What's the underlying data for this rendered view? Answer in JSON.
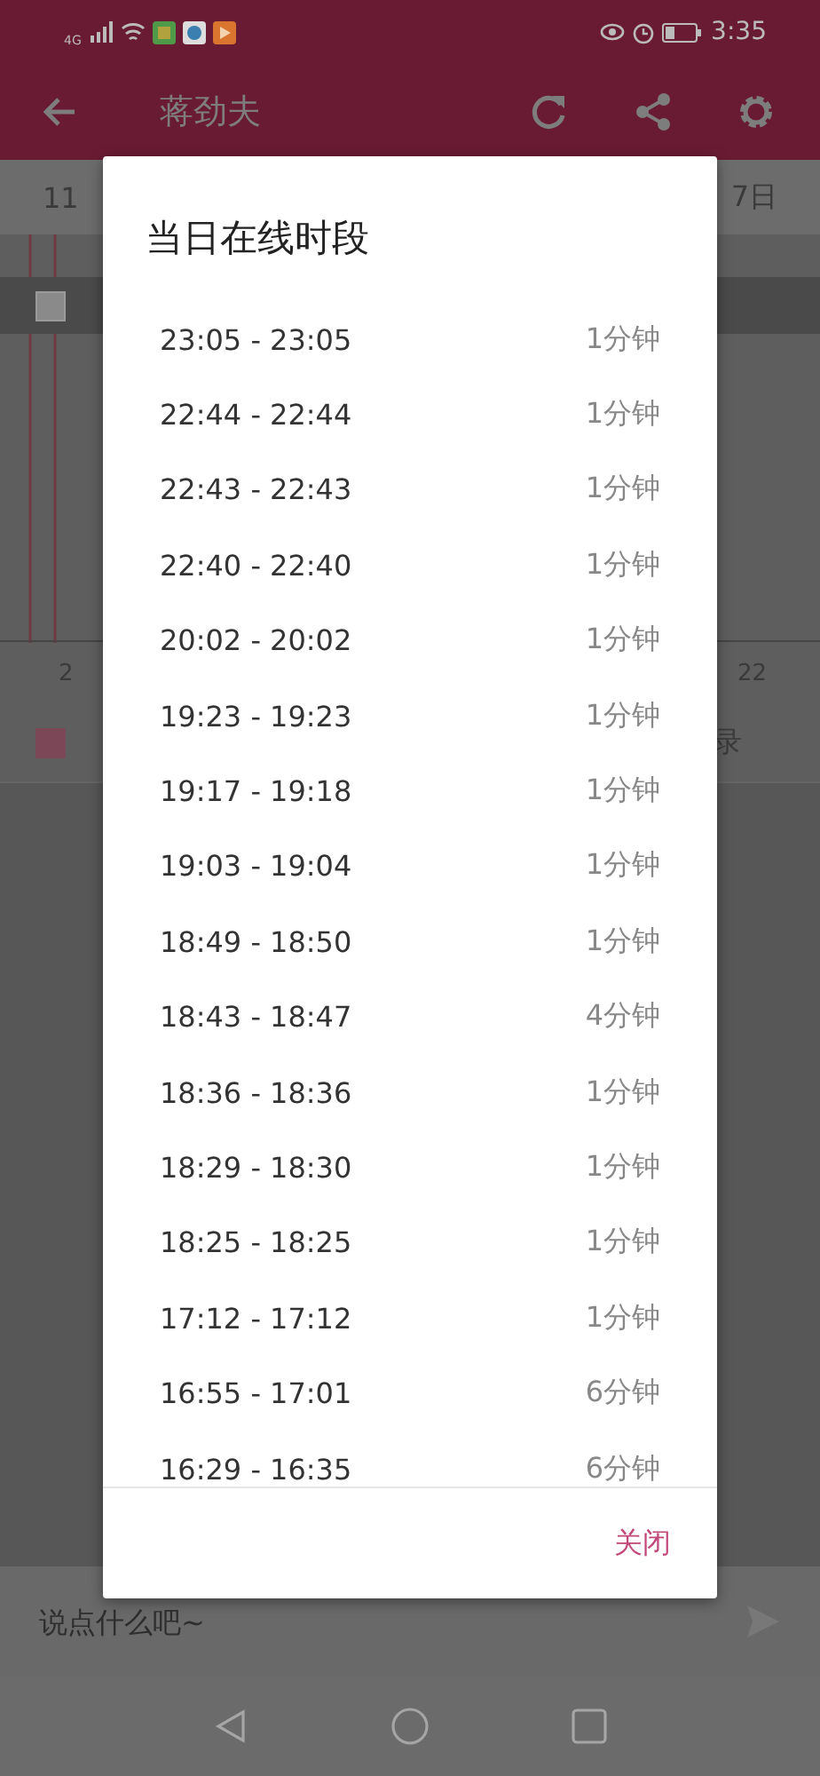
{
  "status_bar": {
    "network": "4G",
    "time": "3:35"
  },
  "header": {
    "title": "蒋劲夫"
  },
  "date_bar": {
    "start": "11",
    "end": "7日"
  },
  "chart": {
    "axis_labels": [
      "2",
      "22"
    ]
  },
  "legend": {
    "checked": false,
    "end_text": "录"
  },
  "input": {
    "placeholder": "说点什么吧~"
  },
  "dialog": {
    "title": "当日在线时段",
    "sessions": [
      {
        "time": "23:05 - 23:05",
        "duration": "1分钟"
      },
      {
        "time": "22:44 - 22:44",
        "duration": "1分钟"
      },
      {
        "time": "22:43 - 22:43",
        "duration": "1分钟"
      },
      {
        "time": "22:40 - 22:40",
        "duration": "1分钟"
      },
      {
        "time": "20:02 - 20:02",
        "duration": "1分钟"
      },
      {
        "time": "19:23 - 19:23",
        "duration": "1分钟"
      },
      {
        "time": "19:17 - 19:18",
        "duration": "1分钟"
      },
      {
        "time": "19:03 - 19:04",
        "duration": "1分钟"
      },
      {
        "time": "18:49 - 18:50",
        "duration": "1分钟"
      },
      {
        "time": "18:43 - 18:47",
        "duration": "4分钟"
      },
      {
        "time": "18:36 - 18:36",
        "duration": "1分钟"
      },
      {
        "time": "18:29 - 18:30",
        "duration": "1分钟"
      },
      {
        "time": "18:25 - 18:25",
        "duration": "1分钟"
      },
      {
        "time": "17:12 - 17:12",
        "duration": "1分钟"
      },
      {
        "time": "16:55 - 17:01",
        "duration": "6分钟"
      },
      {
        "time": "16:29 - 16:35",
        "duration": "6分钟"
      }
    ],
    "close_button": "关闭"
  }
}
